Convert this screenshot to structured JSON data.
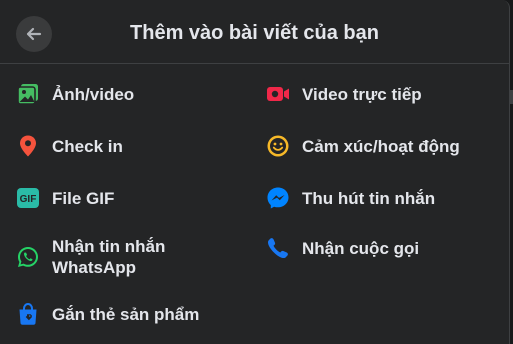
{
  "header": {
    "title": "Thêm vào bài viết của bạn",
    "back_icon": "arrow-left-icon"
  },
  "options": [
    {
      "label": "Ảnh/video",
      "icon": "photo-video-icon",
      "color": "#45bd62"
    },
    {
      "label": "Video trực tiếp",
      "icon": "live-video-icon",
      "color": "#f02849"
    },
    {
      "label": "Check in",
      "icon": "location-pin-icon",
      "color": "#f5533d"
    },
    {
      "label": "Cảm xúc/hoạt động",
      "icon": "smiley-icon",
      "color": "#f7b928"
    },
    {
      "label": "File GIF",
      "icon": "gif-icon",
      "color": "#2abba7"
    },
    {
      "label": "Thu hút tin nhắn",
      "icon": "messenger-icon",
      "color": "#0084ff"
    },
    {
      "label": "Nhận tin nhắn\nWhatsApp",
      "icon": "whatsapp-icon",
      "color": "#25d366"
    },
    {
      "label": "Nhận cuộc gọi",
      "icon": "phone-icon",
      "color": "#1877f2"
    },
    {
      "label": "Gắn thẻ sản phẩm",
      "icon": "shopping-bag-icon",
      "color": "#1877f2"
    }
  ]
}
